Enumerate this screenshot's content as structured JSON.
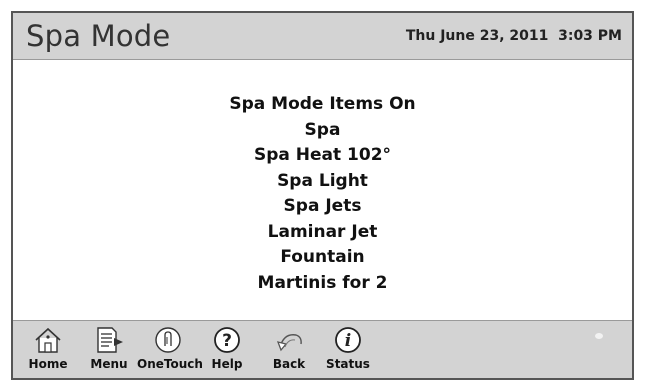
{
  "header": {
    "title": "Spa Mode",
    "datetime": "Thu June 23, 2011  3:03 PM"
  },
  "main": {
    "items": [
      "Spa Mode Items On",
      "Spa",
      "Spa Heat 102°",
      "Spa Light",
      "Spa Jets",
      "Laminar Jet",
      "Fountain",
      "Martinis for 2"
    ]
  },
  "toolbar": {
    "buttons": [
      {
        "label": "Home",
        "icon": "house-icon"
      },
      {
        "label": "Menu",
        "icon": "menu-document-icon"
      },
      {
        "label": "OneTouch",
        "icon": "touch-finger-icon"
      },
      {
        "label": "Help",
        "icon": "question-icon"
      },
      {
        "label": "Back",
        "icon": "back-arrow-icon"
      },
      {
        "label": "Status",
        "icon": "info-icon"
      }
    ]
  }
}
